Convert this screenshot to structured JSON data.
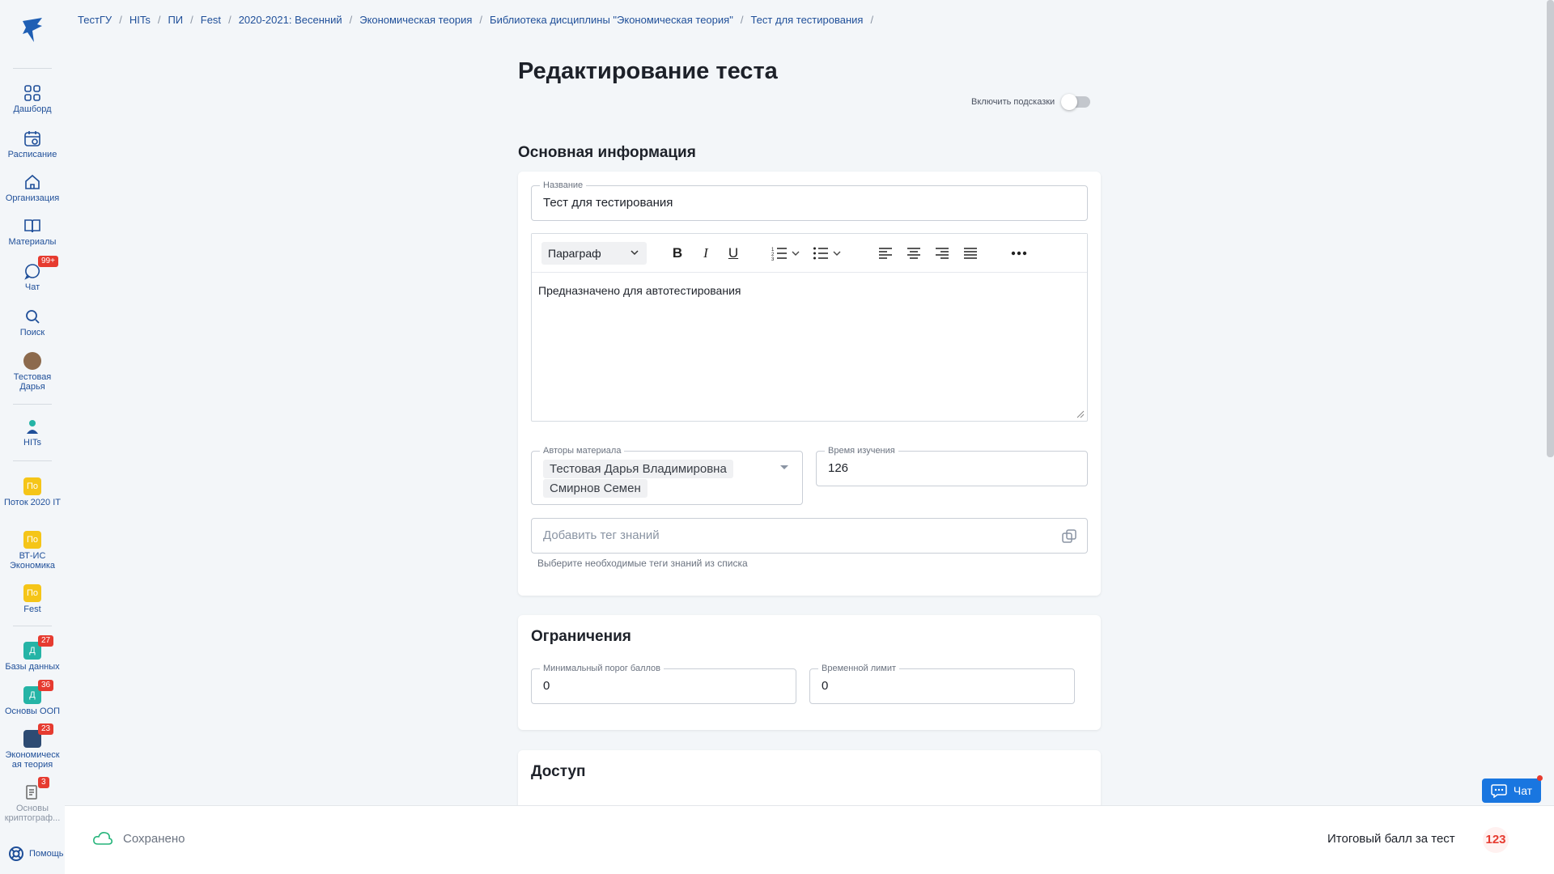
{
  "breadcrumb": [
    "ТестГУ",
    "HITs",
    "ПИ",
    "Fest",
    "2020-2021: Весенний",
    "Экономическая теория",
    "Библиотека дисциплины \"Экономическая теория\"",
    "Тест для тестирования"
  ],
  "sidebar": {
    "items": [
      {
        "label": "Дашборд",
        "icon": "dashboard-icon"
      },
      {
        "label": "Расписание",
        "icon": "calendar-icon"
      },
      {
        "label": "Организация",
        "icon": "home-icon"
      },
      {
        "label": "Материалы",
        "icon": "book-icon"
      },
      {
        "label": "Чат",
        "icon": "chat-icon",
        "badge": "99+"
      },
      {
        "label": "Поиск",
        "icon": "search-icon"
      },
      {
        "label": "Тестовая Дарья",
        "icon": "avatar"
      },
      {
        "label": "HITs",
        "icon": "hits-logo"
      },
      {
        "label": "Поток 2020 IT",
        "square": "По"
      },
      {
        "label": "ВТ-ИС Экономика",
        "square": "По"
      },
      {
        "label": "Fest",
        "square": "По"
      },
      {
        "label": "Базы данных",
        "square": "Д",
        "badge": "27"
      },
      {
        "label": "Основы ООП",
        "square": "Д",
        "badge": "36"
      },
      {
        "label": "Экономическая теория",
        "badge": "23"
      },
      {
        "label": "Основы криптограф...",
        "badge": "3"
      }
    ],
    "help": "Помощь"
  },
  "page": {
    "title": "Редактирование теста",
    "hints_label": "Включить подсказки"
  },
  "basic": {
    "title": "Основная информация",
    "name_label": "Название",
    "name_value": "Тест для тестирования",
    "paragraph": "Параграф",
    "description": "Предназначено для автотестирования",
    "authors_label": "Авторы материала",
    "authors": [
      "Тестовая Дарья Владимировна",
      "Смирнов Семен"
    ],
    "study_time_label": "Время изучения",
    "study_time_value": "126",
    "tag_placeholder": "Добавить тег знаний",
    "tag_helper": "Выберите необходимые теги знаний из списка"
  },
  "limits": {
    "title": "Ограничения",
    "min_score_label": "Минимальный порог баллов",
    "min_score_value": "0",
    "time_limit_label": "Временной лимит",
    "time_limit_value": "0"
  },
  "access": {
    "title": "Доступ"
  },
  "bottom": {
    "saved": "Сохранено",
    "total_label": "Итоговый балл за тест",
    "total_value": "123"
  },
  "chat_button": "Чат",
  "colors": {
    "accent": "#1976e0",
    "link": "#1f4f99",
    "badge": "#e63b30",
    "yellow": "#f5c518"
  }
}
